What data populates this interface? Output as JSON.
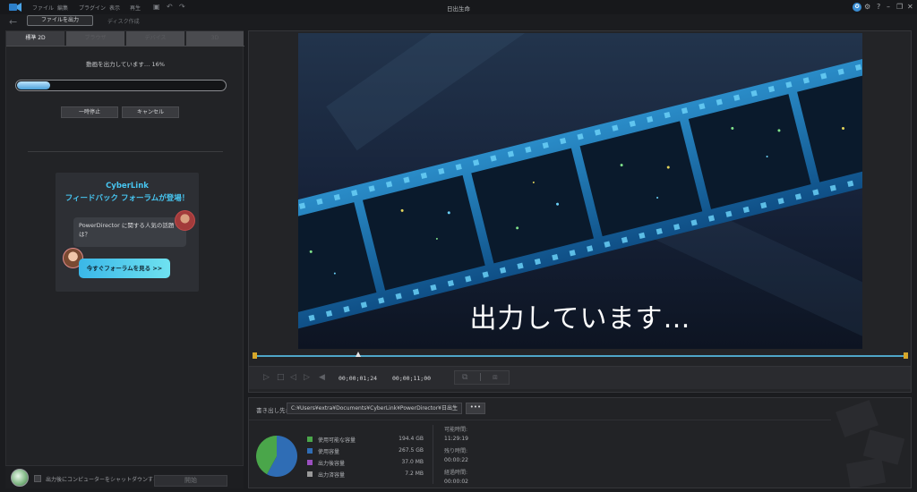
{
  "menu": {
    "items": [
      "ファイル",
      "編集",
      "プラグイン",
      "表示",
      "再生"
    ],
    "window_title": "日出生命"
  },
  "mode_tabs": {
    "file_output": "ファイルを出力",
    "disc": "ディスク作成"
  },
  "left": {
    "subtabs": [
      "標準 2D",
      "ブラウザ",
      "デバイス",
      "3D"
    ],
    "progress_text": "動画を出力しています… 16%",
    "progress_fraction": 0.16,
    "pause_label": "一時停止",
    "cancel_label": "キャンセル",
    "banner": {
      "brand": "CyberLink",
      "title": "フィードバック フォーラムが登場！",
      "bubble": "PowerDirector に関する人気の話題は？",
      "cta": "今すぐフォーラムを見る >>"
    },
    "shutdown_label": "出力後にコンピューターをシャットダウンする",
    "start_label": "開始"
  },
  "preview": {
    "overlay_text": "出力しています…",
    "timecode_current": "00;00;01;24",
    "timecode_total": "00;00;11;00",
    "playhead_fraction": 0.16
  },
  "info": {
    "export_label": "書き出し先:",
    "export_path": "C:¥Users¥extra¥Documents¥CyberLink¥PowerDirector¥日出生",
    "browse_label": "•••",
    "disk": [
      {
        "label": "使用可能な容量",
        "value": "194.4 GB",
        "color": "#4aa64a"
      },
      {
        "label": "使用容量",
        "value": "267.5 GB",
        "color": "#2f6db5"
      },
      {
        "label": "出力後容量",
        "value": "37.0 MB",
        "color": "#9b4fc0"
      },
      {
        "label": "出力済容量",
        "value": "7.2 MB",
        "color": "#9a9a9a"
      }
    ],
    "times": [
      {
        "label": "可能時間:",
        "value": "11:29:19"
      },
      {
        "label": "残り時間:",
        "value": "00:00:22"
      },
      {
        "label": "経過時間:",
        "value": "00:00:02"
      }
    ]
  }
}
